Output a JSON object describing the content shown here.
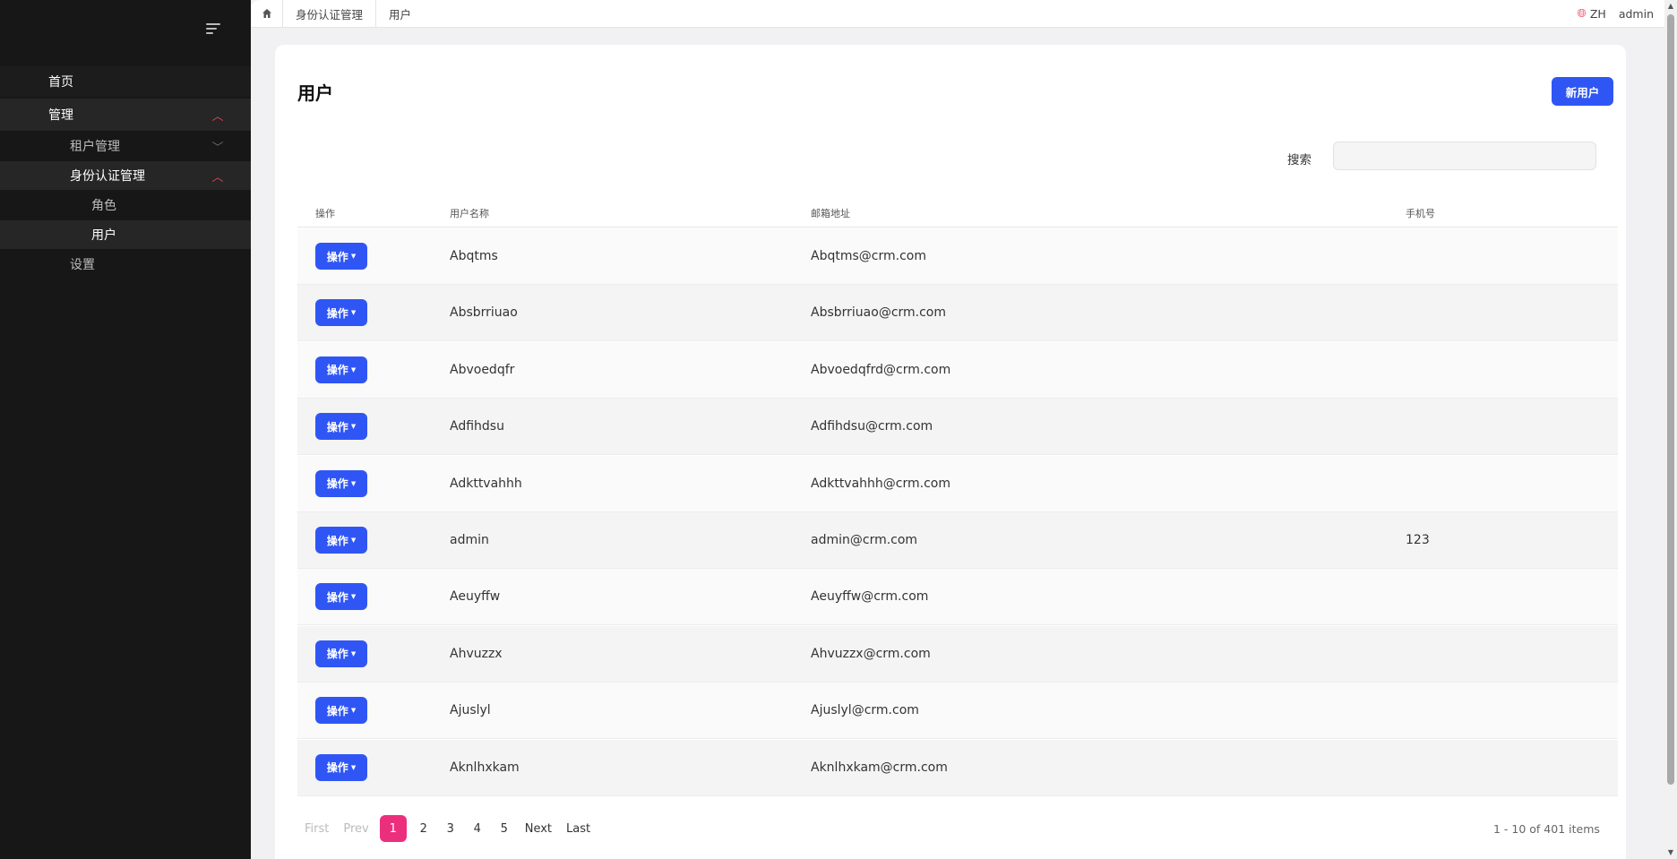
{
  "sidebar": {
    "items": [
      {
        "label": "首页"
      },
      {
        "label": "管理"
      },
      {
        "label": "租户管理"
      },
      {
        "label": "身份认证管理"
      },
      {
        "label": "角色"
      },
      {
        "label": "用户"
      },
      {
        "label": "设置"
      }
    ]
  },
  "topbar": {
    "breadcrumbs": [
      "身份认证管理",
      "用户"
    ],
    "lang": "ZH",
    "user": "admin"
  },
  "main": {
    "title": "用户",
    "new_button": "新用户",
    "search_label": "搜索",
    "search_value": "",
    "columns": [
      "操作",
      "用户名称",
      "邮箱地址",
      "手机号"
    ],
    "action_label": "操作",
    "rows": [
      {
        "name": "Abqtms",
        "email": "Abqtms@crm.com",
        "phone": ""
      },
      {
        "name": "Absbrriuao",
        "email": "Absbrriuao@crm.com",
        "phone": ""
      },
      {
        "name": "Abvoedqfr",
        "email": "Abvoedqfrd@crm.com",
        "phone": ""
      },
      {
        "name": "Adfihdsu",
        "email": "Adfihdsu@crm.com",
        "phone": ""
      },
      {
        "name": "Adkttvahhh",
        "email": "Adkttvahhh@crm.com",
        "phone": ""
      },
      {
        "name": "admin",
        "email": "admin@crm.com",
        "phone": "123"
      },
      {
        "name": "Aeuyffw",
        "email": "Aeuyffw@crm.com",
        "phone": ""
      },
      {
        "name": "Ahvuzzx",
        "email": "Ahvuzzx@crm.com",
        "phone": ""
      },
      {
        "name": "Ajuslyl",
        "email": "Ajuslyl@crm.com",
        "phone": ""
      },
      {
        "name": "Aknlhxkam",
        "email": "Aknlhxkam@crm.com",
        "phone": ""
      }
    ]
  },
  "pagination": {
    "first": "First",
    "prev": "Prev",
    "pages": [
      "1",
      "2",
      "3",
      "4",
      "5"
    ],
    "next": "Next",
    "last": "Last",
    "info": "1 - 10 of 401 items"
  },
  "colors": {
    "sidebar_bg": "#171717",
    "primary": "#2f56f5",
    "active_page": "#ec2f7c",
    "chevron_active": "#e8445a"
  }
}
